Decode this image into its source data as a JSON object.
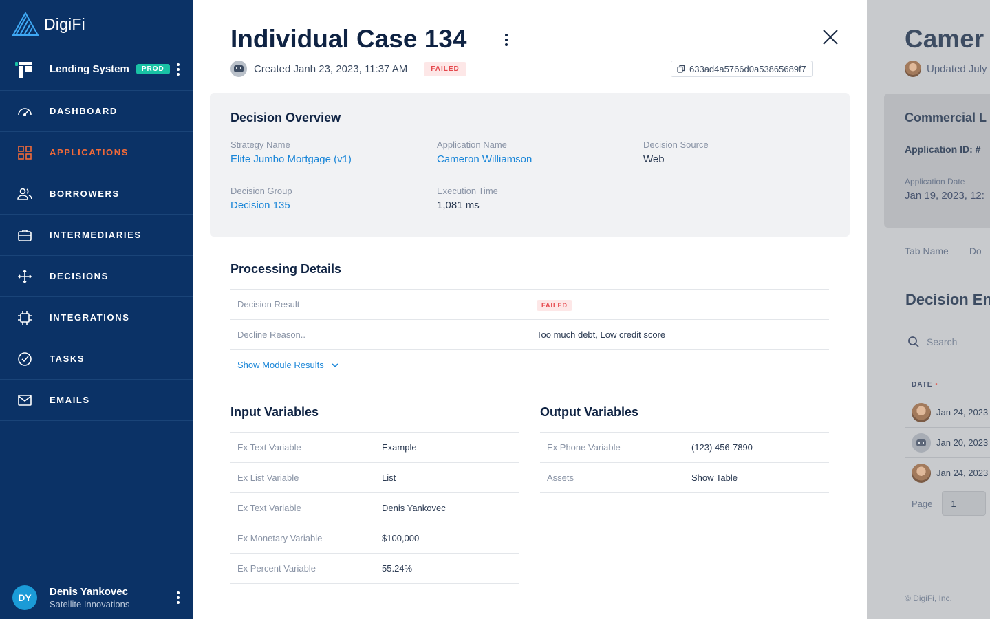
{
  "app": {
    "brand": "DigiFi"
  },
  "sidebar": {
    "system_name": "Lending System",
    "system_badge": "PROD",
    "nav": [
      {
        "label": "DASHBOARD",
        "icon": "speedometer-icon",
        "active": false
      },
      {
        "label": "APPLICATIONS",
        "icon": "grid-icon",
        "active": true
      },
      {
        "label": "BORROWERS",
        "icon": "users-icon",
        "active": false
      },
      {
        "label": "INTERMEDIARIES",
        "icon": "briefcase-icon",
        "active": false
      },
      {
        "label": "DECISIONS",
        "icon": "decision-flow-icon",
        "active": false
      },
      {
        "label": "INTEGRATIONS",
        "icon": "chip-icon",
        "active": false
      },
      {
        "label": "TASKS",
        "icon": "check-circle-icon",
        "active": false
      },
      {
        "label": "EMAILS",
        "icon": "mail-icon",
        "active": false
      }
    ],
    "user": {
      "initials": "DY",
      "name": "Denis Yankovec",
      "org": "Satellite Innovations"
    }
  },
  "case": {
    "title": "Individual Case 134",
    "created": "Created Janh 23, 2023, 11:37 AM",
    "status": "FAILED",
    "id": "633ad4a5766d0a53865689f7"
  },
  "overview": {
    "title": "Decision Overview",
    "strategy_label": "Strategy Name",
    "strategy_value": "Elite Jumbo Mortgage (v1)",
    "application_label": "Application Name",
    "application_value": "Cameron Williamson",
    "source_label": "Decision Source",
    "source_value": "Web",
    "group_label": "Decision Group",
    "group_value": "Decision 135",
    "execution_label": "Execution Time",
    "execution_value": "1,081 ms"
  },
  "processing": {
    "title": "Processing Details",
    "result_label": "Decision Result",
    "result_value": "FAILED",
    "decline_label": "Decline Reason..",
    "decline_value": "Too much debt, Low credit score",
    "show_modules": "Show Module Results"
  },
  "inputs": {
    "title": "Input Variables",
    "rows": [
      {
        "k": "Ex Text Variable",
        "v": "Example"
      },
      {
        "k": "Ex List Variable",
        "v": "List"
      },
      {
        "k": "Ex Text Variable",
        "v": "Denis Yankovec"
      },
      {
        "k": "Ex Monetary Variable",
        "v": "$100,000"
      },
      {
        "k": "Ex Percent Variable",
        "v": "55.24%"
      }
    ]
  },
  "outputs": {
    "title": "Output Variables",
    "rows": [
      {
        "k": "Ex Phone Variable",
        "v": "(123) 456-7890"
      },
      {
        "k": "Assets",
        "v": "Show Table"
      }
    ]
  },
  "background": {
    "title": "Camer",
    "updated": "Updated July",
    "card_title": "Commercial L",
    "app_id": "Application ID: #",
    "app_date_label": "Application Date",
    "app_date": "Jan 19, 2023, 12:",
    "tabs": [
      "Tab Name",
      "Do"
    ],
    "section_title": "Decision En",
    "search_placeholder": "Search",
    "date_header": "DATE",
    "rows": [
      "Jan 24, 2023",
      "Jan 20, 2023",
      "Jan 24, 2023"
    ],
    "page_label": "Page",
    "page_value": "1",
    "footer": "© DigiFi, Inc."
  },
  "colors": {
    "sidebar_bg": "#0b3266",
    "accent": "#f26a38",
    "link": "#1a86d8",
    "failed": "#e5484d",
    "prod_badge": "#19c2a5"
  }
}
